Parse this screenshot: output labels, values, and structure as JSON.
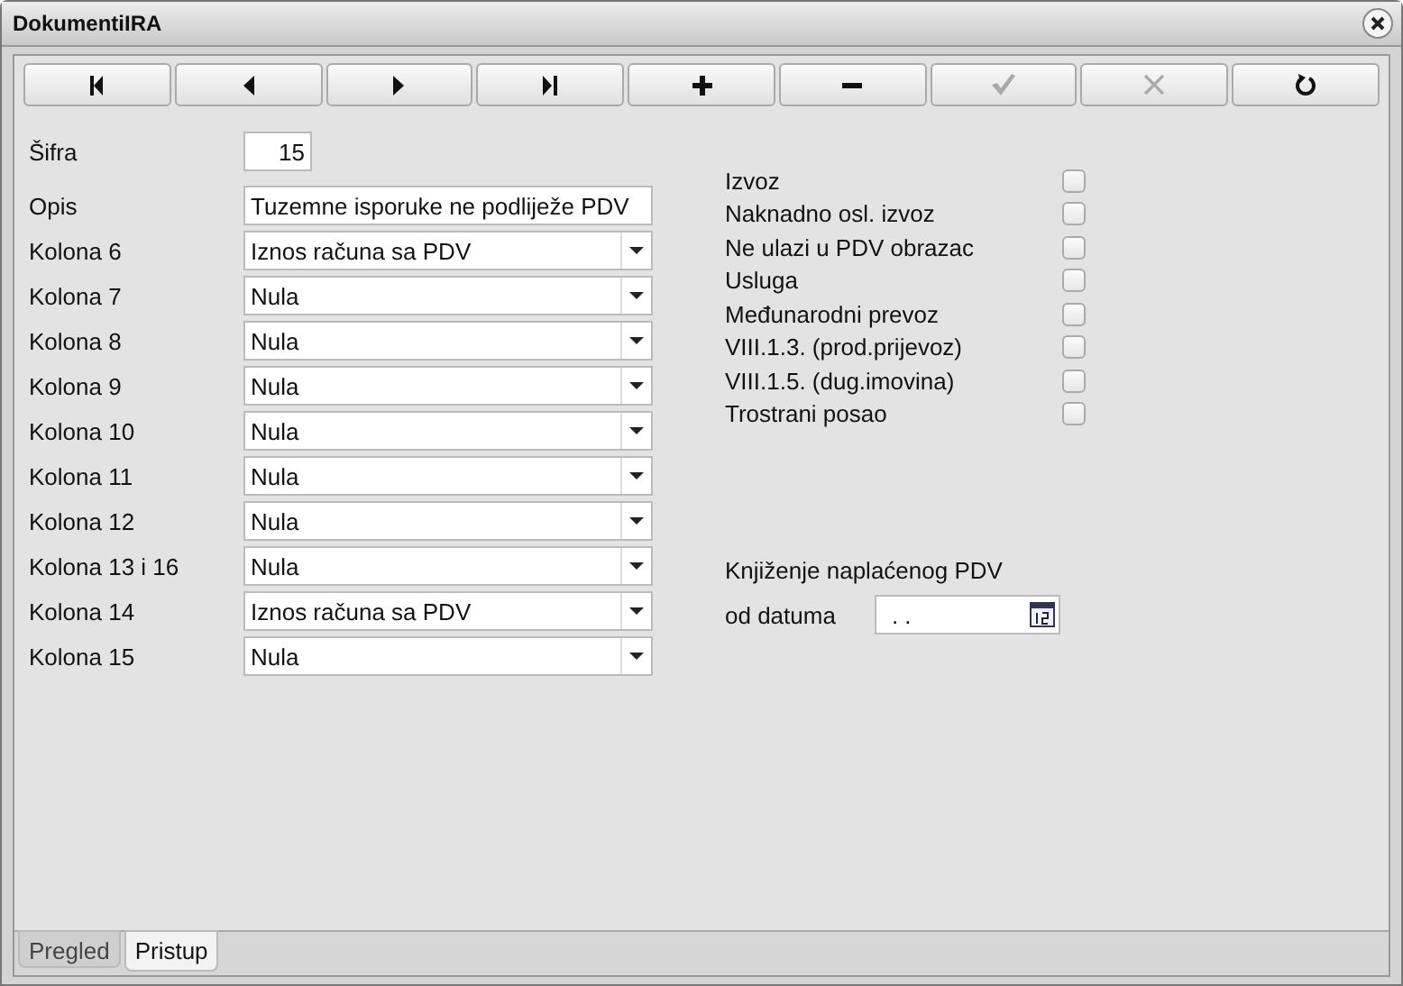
{
  "window": {
    "title": "DokumentiIRA"
  },
  "toolbar": [
    {
      "kind": "first",
      "disabled": false
    },
    {
      "kind": "prev",
      "disabled": false
    },
    {
      "kind": "next",
      "disabled": false
    },
    {
      "kind": "last",
      "disabled": false
    },
    {
      "kind": "add",
      "disabled": false
    },
    {
      "kind": "remove",
      "disabled": false
    },
    {
      "kind": "confirm",
      "disabled": true
    },
    {
      "kind": "cancel",
      "disabled": true
    },
    {
      "kind": "refresh",
      "disabled": false
    }
  ],
  "fields": [
    {
      "kind": "number",
      "label": "Šifra",
      "value": "15"
    },
    {
      "kind": "text",
      "label": "Opis",
      "value": "Tuzemne isporuke ne podliježe PDV"
    },
    {
      "kind": "select",
      "label": "Kolona 6",
      "value": "Iznos računa sa PDV"
    },
    {
      "kind": "select",
      "label": "Kolona 7",
      "value": "Nula"
    },
    {
      "kind": "select",
      "label": "Kolona 8",
      "value": "Nula"
    },
    {
      "kind": "select",
      "label": "Kolona 9",
      "value": "Nula"
    },
    {
      "kind": "select",
      "label": "Kolona 10",
      "value": "Nula"
    },
    {
      "kind": "select",
      "label": "Kolona 11",
      "value": "Nula"
    },
    {
      "kind": "select",
      "label": "Kolona 12",
      "value": "Nula"
    },
    {
      "kind": "select",
      "label": "Kolona 13 i 16",
      "value": "Nula"
    },
    {
      "kind": "select",
      "label": "Kolona 14",
      "value": "Iznos računa sa PDV"
    },
    {
      "kind": "select",
      "label": "Kolona 15",
      "value": "Nula"
    }
  ],
  "checkboxes": [
    {
      "label": "Izvoz",
      "checked": false
    },
    {
      "label": "Naknadno osl. izvoz",
      "checked": false
    },
    {
      "label": "Ne ulazi u PDV obrazac",
      "checked": false
    },
    {
      "label": "Usluga",
      "checked": false
    },
    {
      "label": "Međunarodni prevoz",
      "checked": false
    },
    {
      "label": "VIII.1.3. (prod.prijevoz)",
      "checked": false
    },
    {
      "label": "VIII.1.5. (dug.imovina)",
      "checked": false
    },
    {
      "label": "Trostrani posao",
      "checked": false
    }
  ],
  "posting": {
    "heading": "Knjiženje naplaćenog PDV",
    "date_label": "od datuma",
    "date_value": ". ."
  },
  "tabs": [
    {
      "label": "Pregled",
      "selected": false
    },
    {
      "label": "Pristup",
      "selected": true
    }
  ]
}
